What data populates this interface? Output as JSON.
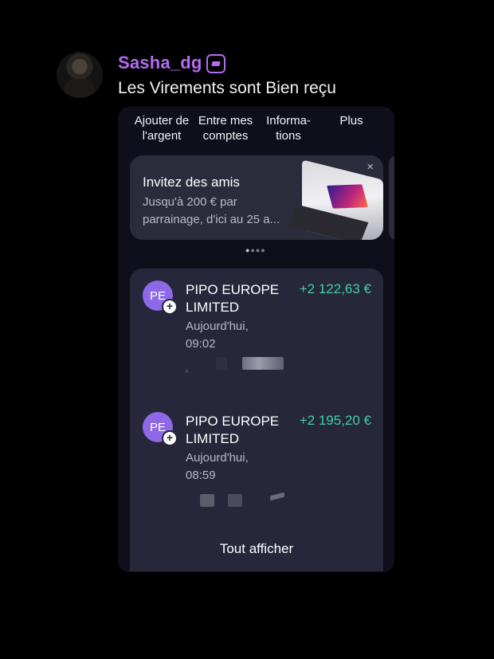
{
  "comment": {
    "username": "Sasha_dg",
    "badge_icon": "graduation-cap-icon",
    "text": "Les Virements sont Bien reçu"
  },
  "app": {
    "actions": [
      {
        "line1": "Ajouter de",
        "line2": "l'argent"
      },
      {
        "line1": "Entre mes",
        "line2": "comptes"
      },
      {
        "line1": "Informa-",
        "line2": "tions"
      },
      {
        "line1": "Plus",
        "line2": ""
      }
    ],
    "promo": {
      "title": "Invitez des amis",
      "text": "Jusqu'à 200 € par parrainage, d'ici au 25 a...",
      "close": "×"
    },
    "transactions": [
      {
        "initials": "PE",
        "name": "PIPO EUROPE LIMITED",
        "amount": "+2 122,63 €",
        "date": "Aujourd'hui, 09:02"
      },
      {
        "initials": "PE",
        "name": "PIPO EUROPE LIMITED",
        "amount": "+2 195,20 €",
        "date": "Aujourd'hui, 08:59"
      }
    ],
    "show_all": "Tout afficher",
    "colors": {
      "accent": "#b36cf2",
      "positive": "#3ed1a4",
      "avatar": "#8e68e6"
    }
  }
}
